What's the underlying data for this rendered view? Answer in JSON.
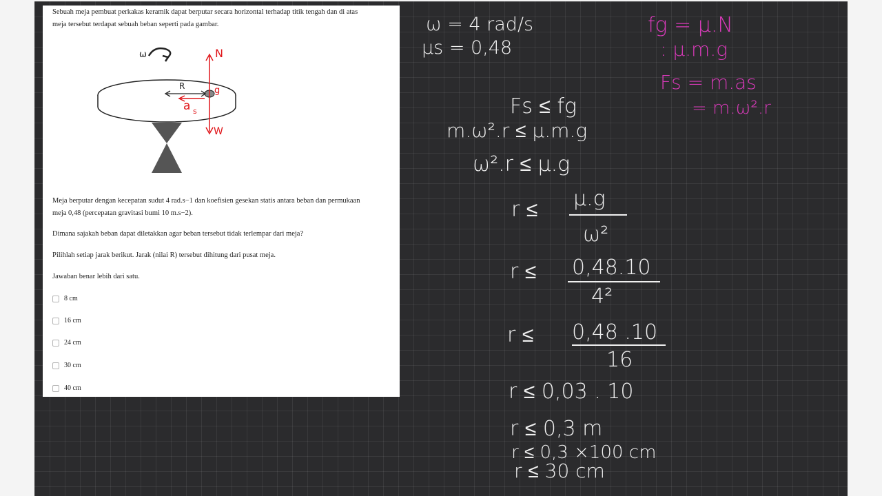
{
  "question": {
    "intro": [
      "Sebuah meja pembuat perkakas keramik dapat berputar secara horizontal terhadap titik tengah dan di atas",
      "meja tersebut terdapat sebuah beban seperti pada gambar."
    ],
    "body": [
      "Meja berputar dengan kecepatan sudut 4 rad.s−1 dan koefisien gesekan statis antara beban dan permukaan",
      "meja 0,48 (percepatan gravitasi bumi 10 m.s−2)."
    ],
    "prompt": "Dimana sajakah beban dapat diletakkan agar beban tersebut tidak terlempar dari meja?",
    "instruction": "Pilihlah setiap jarak berikut. Jarak (nilai R) tersebut dihitung dari pusat meja.",
    "note": "Jawaban benar lebih dari satu.",
    "options": [
      "8 cm",
      "16 cm",
      "24 cm",
      "30 cm",
      "40 cm"
    ]
  },
  "figure": {
    "omega_label": "ω",
    "radius_label": "R",
    "normal_label": "N",
    "weight_label": "W",
    "friction_label": "g",
    "accel_label": "a",
    "accel_sub": "s"
  },
  "notes": {
    "given_omega": "ω = 4 rad/s",
    "given_mu": "μs = 0,48",
    "fg_def1": "fg = μ.N",
    "fg_def2": ": μ.m.g",
    "fs_def1": "Fs = m.as",
    "fs_def2": "= m.ω².r",
    "step1": "Fs ≤ fg",
    "step2": "m.ω².r ≤ μ.m.g",
    "step3": "ω².r ≤ μ.g",
    "step4_lhs": "r ≤",
    "step4_num": "μ.g",
    "step4_den": "ω²",
    "step5_lhs": "r ≤",
    "step5_num": "0,48.10",
    "step5_den": "4²",
    "step6_lhs": "r ≤",
    "step6_num": "0,48 .10",
    "step6_den": "16",
    "step7": "r ≤  0,03 . 10",
    "step8": "r ≤  0,3  m",
    "step9": "r ≤  0,3 ×100 cm",
    "step10": "r ≤  30  cm"
  },
  "colors": {
    "ink": "#f0f0f0",
    "magenta": "#d83ab9",
    "red": "#e0161a",
    "board": "#2b2b2d"
  }
}
